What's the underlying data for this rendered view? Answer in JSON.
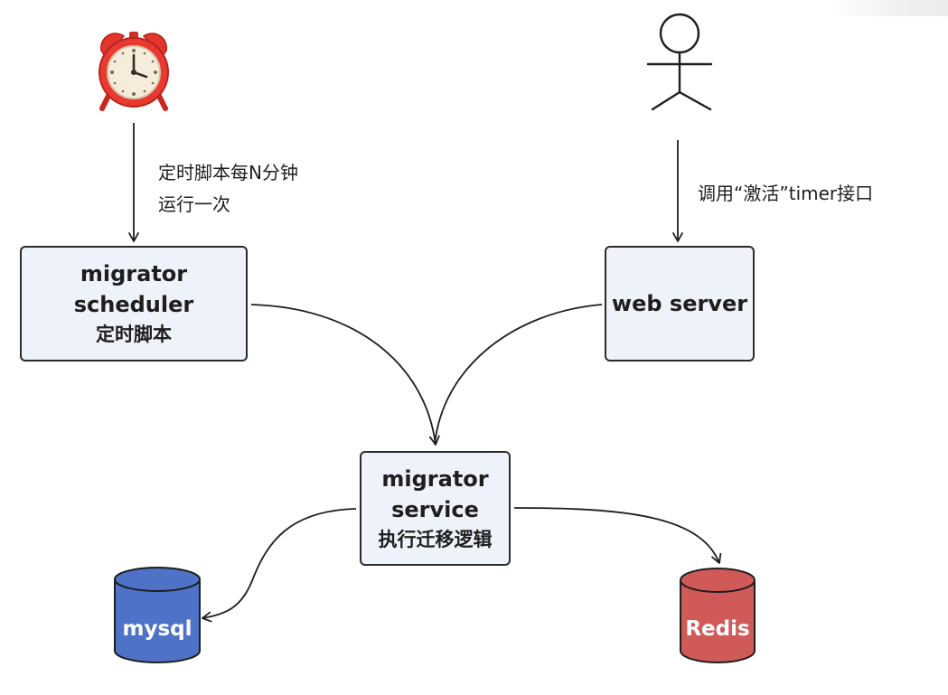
{
  "nodes": {
    "scheduler": {
      "line1": "migrator scheduler",
      "line2": "定时脚本"
    },
    "web_server": {
      "line1": "web server"
    },
    "service": {
      "line1": "migrator",
      "line2": "service",
      "line3": "执行迁移逻辑"
    }
  },
  "edges": {
    "cron_label": {
      "line1": "定时脚本每N分钟",
      "line2": "运行一次"
    },
    "activate_label": "调用“激活”timer接口"
  },
  "databases": {
    "mysql": {
      "label": "mysql",
      "color": "#4f72c9"
    },
    "redis": {
      "label": "Redis",
      "color": "#d05a58"
    }
  },
  "icons": {
    "clock": "alarm-clock-icon",
    "user": "stick-figure-user-icon"
  },
  "colors": {
    "node_fill": "#eef2fb",
    "stroke": "#1e1e1e",
    "clock_red": "#e83a30"
  }
}
